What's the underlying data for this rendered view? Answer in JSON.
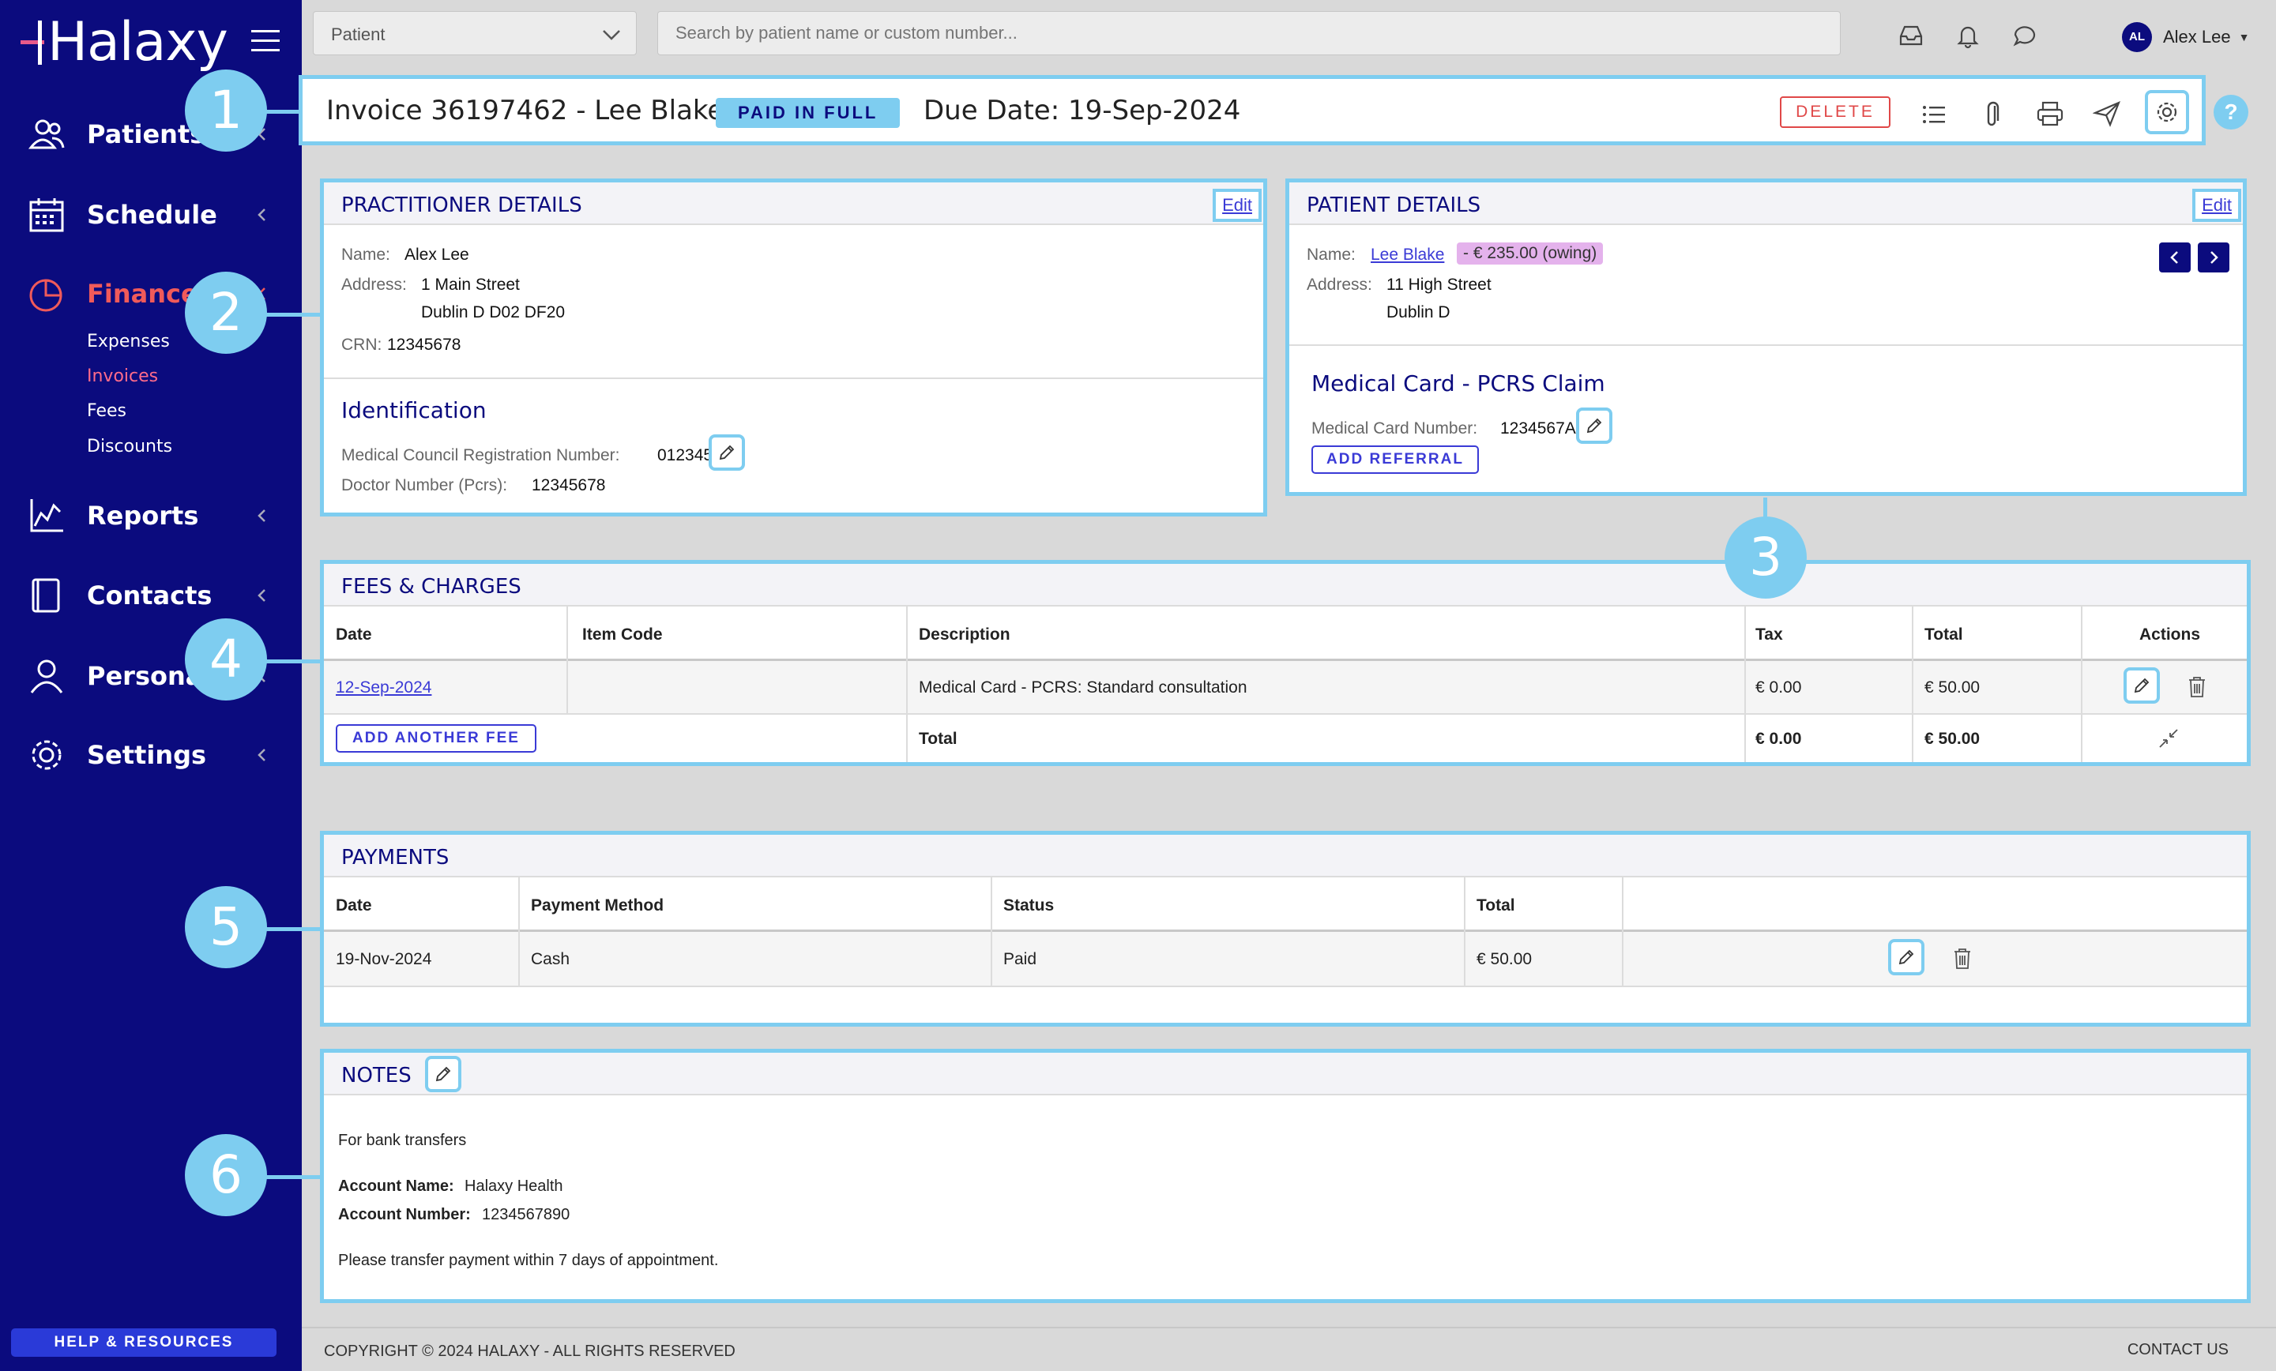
{
  "app": {
    "logo_text": "Halaxy",
    "search_placeholder": "Search by patient name or custom number...",
    "patient_select": "Patient",
    "user": {
      "initials": "AL",
      "name": "Alex Lee"
    }
  },
  "sidebar": {
    "items": [
      {
        "label": "Patients",
        "icon": "patients-icon"
      },
      {
        "label": "Schedule",
        "icon": "calendar-icon"
      },
      {
        "label": "Finances",
        "icon": "pie-chart-icon",
        "active": true
      },
      {
        "label": "Reports",
        "icon": "chart-icon"
      },
      {
        "label": "Contacts",
        "icon": "book-icon"
      },
      {
        "label": "Personal",
        "icon": "user-icon"
      },
      {
        "label": "Settings",
        "icon": "gear-icon"
      }
    ],
    "finances_sub": [
      "Expenses",
      "Invoices",
      "Fees",
      "Discounts"
    ],
    "help_label": "HELP & RESOURCES"
  },
  "invoice": {
    "title": "Invoice 36197462 - Lee Blake",
    "status": "PAID IN FULL",
    "due_date": "Due Date: 19-Sep-2024",
    "delete_label": "DELETE"
  },
  "practitioner": {
    "section_title": "PRACTITIONER DETAILS",
    "edit_label": "Edit",
    "name_label": "Name:",
    "name": "Alex Lee",
    "address_label": "Address:",
    "address_line1": "1 Main Street",
    "address_line2": "Dublin D D02 DF20",
    "crn_label": "CRN:",
    "crn": "12345678",
    "identification_title": "Identification",
    "mcrn_label": "Medical Council Registration Number:",
    "mcrn": "012345",
    "doctor_number_label": "Doctor Number (Pcrs):",
    "doctor_number": "12345678"
  },
  "patient": {
    "section_title": "PATIENT DETAILS",
    "edit_label": "Edit",
    "name_label": "Name:",
    "name": "Lee Blake",
    "owing": "- € 235.00 (owing)",
    "address_label": "Address:",
    "address_line1": "11 High Street",
    "address_line2": "Dublin D",
    "claim_title": "Medical Card - PCRS Claim",
    "card_number_label": "Medical Card Number:",
    "card_number": "1234567A",
    "add_referral_label": "ADD REFERRAL"
  },
  "fees": {
    "section_title": "FEES & CHARGES",
    "columns": [
      "Date",
      "Item Code",
      "Description",
      "Tax",
      "Total",
      "Actions"
    ],
    "row": {
      "date": "12-Sep-2024",
      "item_code": "",
      "description": "Medical Card - PCRS: Standard consultation",
      "tax": "€ 0.00",
      "total": "€ 50.00"
    },
    "add_label": "ADD ANOTHER FEE",
    "total_label": "Total",
    "total_tax": "€ 0.00",
    "total_amount": "€ 50.00"
  },
  "payments": {
    "section_title": "PAYMENTS",
    "columns": [
      "Date",
      "Payment Method",
      "Status",
      "Total"
    ],
    "row": {
      "date": "19-Nov-2024",
      "method": "Cash",
      "status": "Paid",
      "total": "€ 50.00"
    }
  },
  "notes": {
    "section_title": "NOTES",
    "line1": "For bank transfers",
    "account_name_label": "Account Name:",
    "account_name": "Halaxy Health",
    "account_number_label": "Account Number:",
    "account_number": "1234567890",
    "line4": "Please transfer payment within 7 days of appointment."
  },
  "callouts": [
    "1",
    "2",
    "3",
    "4",
    "5",
    "6"
  ],
  "footer": {
    "copyright": "COPYRIGHT © 2024 HALAXY - ALL RIGHTS RESERVED",
    "contact": "CONTACT US"
  },
  "colors": {
    "sidebar": "#0b0b7e",
    "highlight": "#7ecdf0",
    "accent": "#3a3ad6",
    "danger": "#e04848",
    "active_nav": "#f05a5a"
  }
}
